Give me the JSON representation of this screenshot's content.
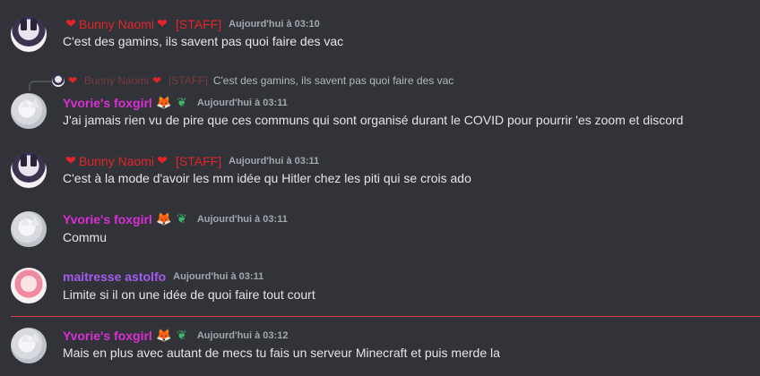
{
  "messages": [
    {
      "author": "Bunny Naomi",
      "tag": "[STAFF]",
      "timestamp": "Aujourd'hui à 03:10",
      "text": "C'est des gamins,  ils savent pas quoi faire des vac"
    },
    {
      "reply": {
        "author": "Bunny Naomi",
        "tag": "[STAFF]",
        "text": "C'est des gamins,  ils savent pas quoi faire des vac"
      },
      "author": "Yvorie's foxgirl",
      "timestamp": "Aujourd'hui à 03:11",
      "text": "J'ai jamais rien vu de pire que ces communs qui sont organisé durant le COVID pour pourrir 'es zoom et discord"
    },
    {
      "author": "Bunny Naomi",
      "tag": "[STAFF]",
      "timestamp": "Aujourd'hui à 03:11",
      "text": "C'est à la mode d'avoir les mm idée qu Hitler chez les piti qui se crois ado"
    },
    {
      "author": "Yvorie's foxgirl",
      "timestamp": "Aujourd'hui à 03:11",
      "text": "Commu"
    },
    {
      "author": "maitresse astolfo",
      "timestamp": "Aujourd'hui à 03:11",
      "text": "Limite si il on une idée de quoi faire tout court"
    },
    {
      "author": "Yvorie's foxgirl",
      "timestamp": "Aujourd'hui à 03:12",
      "text": "Mais en plus avec autant de mecs tu fais un serveur Minecraft et puis merde la"
    }
  ],
  "icons": {
    "heart": "heart-icon",
    "fox": "fox-icon",
    "sprout": "sprout-icon"
  },
  "colors": {
    "background": "#313338",
    "staff_red": "#e3242b",
    "foxgirl_pink": "#db2fd6",
    "astolfo_purple": "#a45cf0",
    "new_messages_line": "#e23b3f"
  }
}
